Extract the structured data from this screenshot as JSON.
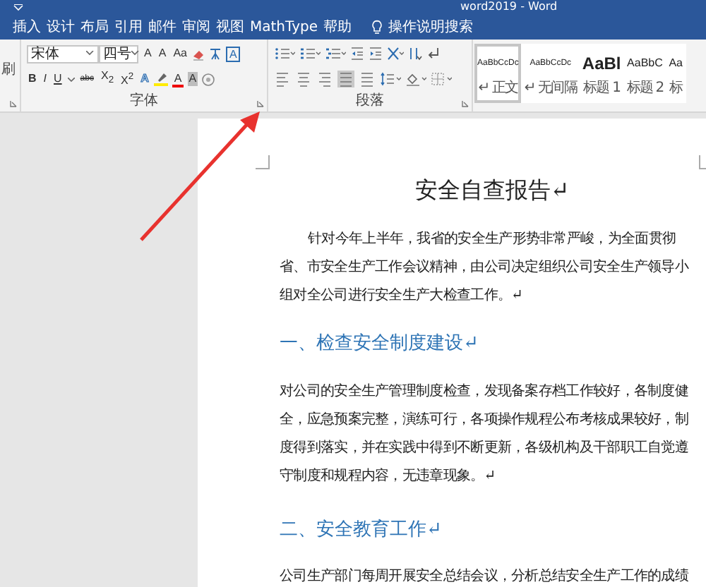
{
  "window": {
    "title": "word2019 - Word"
  },
  "tabs": [
    {
      "label": "插入"
    },
    {
      "label": "设计"
    },
    {
      "label": "布局"
    },
    {
      "label": "引用"
    },
    {
      "label": "邮件"
    },
    {
      "label": "审阅"
    },
    {
      "label": "视图"
    },
    {
      "label": "MathType"
    },
    {
      "label": "帮助"
    }
  ],
  "tell_me": {
    "label": "操作说明搜索"
  },
  "clipboard_group": {
    "label": "刷"
  },
  "font_group": {
    "font": "宋体",
    "size": "四号",
    "grow": "A",
    "shrink": "A",
    "change_case": "Aa",
    "border": "A",
    "bold": "B",
    "italic": "I",
    "underline": "U",
    "strikethrough": "abc",
    "subscript": "X$_{2}$",
    "superscript": "X$^{2}$",
    "effects": "A",
    "font_color": "A",
    "shading": "A",
    "label": "字体"
  },
  "paragraph_group": {
    "label": "段落"
  },
  "styles": [
    {
      "preview": "AaBbCcDc",
      "name": "↵ 正文",
      "kind": "normal",
      "selected": true
    },
    {
      "preview": "AaBbCcDc",
      "name": "↵ 无间隔",
      "kind": "normal",
      "selected": false
    },
    {
      "preview": "AaBl",
      "name": "标题 1",
      "kind": "heading1",
      "selected": false
    },
    {
      "preview": "AaBbC",
      "name": "标题 2",
      "kind": "heading2",
      "selected": false
    },
    {
      "preview": "Aa",
      "name": "标",
      "kind": "heading2",
      "selected": false
    }
  ],
  "document": [
    {
      "kind": "title",
      "text": "安全自查报告↵"
    },
    {
      "kind": "body",
      "indent": true,
      "text": "针对今年上半年，我省的安全生产形势非常严峻，为全面贯彻省、市安全生产工作会议精神，由公司决定组织公司安全生产领导小组对全公司进行安全生产大检查工作。↵"
    },
    {
      "kind": "heading",
      "text": "一、检查安全制度建设↵"
    },
    {
      "kind": "body",
      "indent": false,
      "text": "对公司的安全生产管理制度检查，发现备案存档工作较好，各制度健全，应急预案完整，演练可行，各项操作规程公布考核成果较好，制度得到落实，并在实践中得到不断更新，各级机构及干部职工自觉遵守制度和规程内容，无违章现象。↵"
    },
    {
      "kind": "heading",
      "text": "二、安全教育工作↵"
    },
    {
      "kind": "body",
      "indent": false,
      "text": "公司生产部门每周开展安全总结会议，分析总结安全生产工作的成绩"
    }
  ]
}
